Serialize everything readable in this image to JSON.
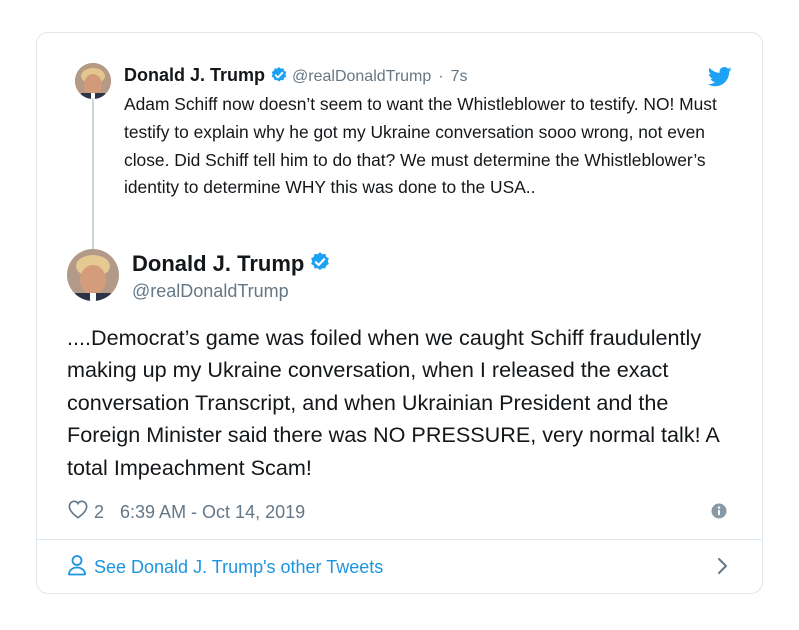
{
  "parent_tweet": {
    "author_name": "Donald J. Trump",
    "handle": "@realDonaldTrump",
    "separator": "·",
    "time": "7s",
    "text": "Adam Schiff now doesn’t seem to want the Whistleblower to testify. NO! Must testify to explain why he got my Ukraine conversation sooo wrong, not even close. Did Schiff tell him to do that? We must determine the Whistleblower’s identity to determine WHY this was done to the USA.."
  },
  "main_tweet": {
    "author_name": "Donald J. Trump",
    "handle": "@realDonaldTrump",
    "text": "....Democrat’s game was foiled when we caught Schiff fraudulently making up my Ukraine conversation, when I released the exact conversation Transcript, and when Ukrainian President and the Foreign Minister said there was NO PRESSURE, very normal talk! A total Impeachment Scam!",
    "like_count": "2",
    "timestamp": "6:39 AM - Oct 14, 2019"
  },
  "footer": {
    "link_label": "See Donald J. Trump's other Tweets"
  },
  "icons": {
    "verified": "verified-badge-icon",
    "brand": "twitter-bird-icon",
    "like": "heart-outline-icon",
    "info": "info-circle-icon",
    "profile": "person-outline-icon",
    "chevron": "chevron-right-icon"
  },
  "colors": {
    "brand_blue": "#1da1f2",
    "link_blue": "#1b95e0",
    "text": "#14171a",
    "secondary": "#657786",
    "border": "#e1e8ed"
  }
}
